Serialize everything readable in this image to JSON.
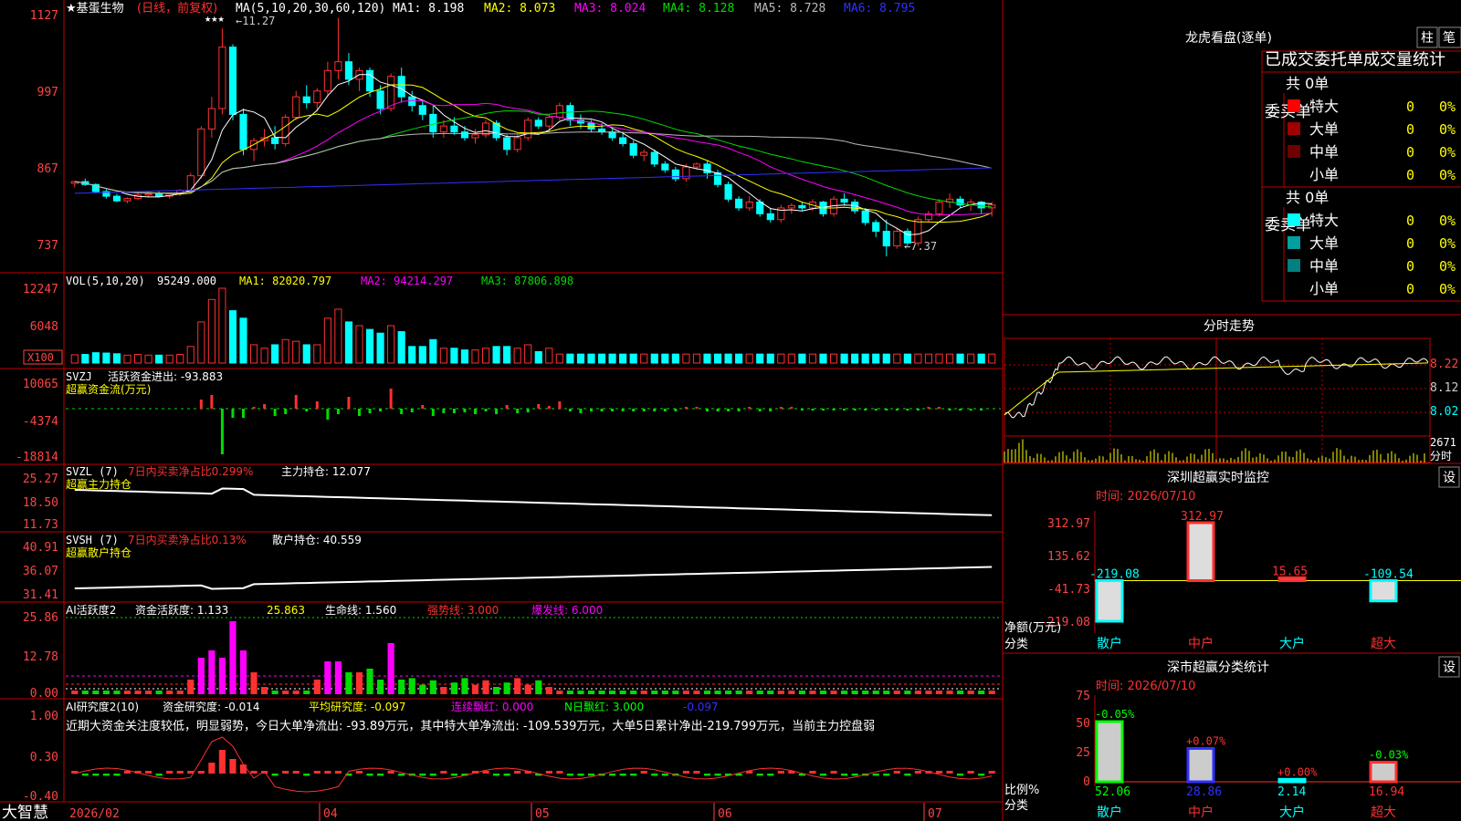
{
  "colors": {
    "up": "#ff3030",
    "down": "#00ffff",
    "frame": "#c00000",
    "white": "#ffffff",
    "yellow": "#ffff00",
    "magenta": "#ff00ff",
    "green": "#00dd00",
    "blue": "#3030ff",
    "gray": "#bbbbbb",
    "label": "#ff4444"
  },
  "main": {
    "stock_name": "★基蛋生物",
    "period": "(日线，前复权)",
    "ma_label": "MA(5,10,20,30,60,120)",
    "ma1": "MA1: 8.198",
    "ma2": "MA2: 8.073",
    "ma3": "MA3: 8.024",
    "ma4": "MA4: 8.128",
    "ma5": "MA5: 8.728",
    "ma6": "MA6: 8.795",
    "high_mark": "←11.27",
    "low_mark": "←7.37",
    "stars": "★★★",
    "y_ticks": [
      "1127",
      "997",
      "867",
      "737"
    ],
    "candles": [
      [
        8.62,
        8.66,
        8.55,
        8.65
      ],
      [
        8.65,
        8.7,
        8.58,
        8.6
      ],
      [
        8.6,
        8.62,
        8.45,
        8.48
      ],
      [
        8.48,
        8.52,
        8.36,
        8.4
      ],
      [
        8.4,
        8.44,
        8.3,
        8.32
      ],
      [
        8.32,
        8.38,
        8.28,
        8.36
      ],
      [
        8.36,
        8.45,
        8.33,
        8.42
      ],
      [
        8.42,
        8.48,
        8.38,
        8.44
      ],
      [
        8.44,
        8.48,
        8.38,
        8.4
      ],
      [
        8.4,
        8.46,
        8.36,
        8.44
      ],
      [
        8.44,
        8.52,
        8.4,
        8.5
      ],
      [
        8.5,
        8.8,
        8.45,
        8.75
      ],
      [
        8.75,
        9.6,
        8.7,
        9.55
      ],
      [
        9.55,
        10.1,
        9.4,
        9.9
      ],
      [
        9.9,
        11.27,
        9.8,
        10.95
      ],
      [
        10.95,
        11.0,
        9.7,
        9.8
      ],
      [
        9.8,
        9.9,
        9.1,
        9.2
      ],
      [
        9.2,
        9.4,
        9.0,
        9.35
      ],
      [
        9.35,
        9.55,
        9.25,
        9.4
      ],
      [
        9.4,
        9.6,
        9.2,
        9.3
      ],
      [
        9.3,
        9.8,
        9.25,
        9.75
      ],
      [
        9.75,
        10.2,
        9.7,
        10.1
      ],
      [
        10.1,
        10.3,
        9.9,
        10.0
      ],
      [
        10.0,
        10.25,
        9.85,
        10.2
      ],
      [
        10.2,
        10.7,
        10.1,
        10.55
      ],
      [
        10.55,
        11.45,
        10.4,
        10.7
      ],
      [
        10.7,
        10.85,
        10.3,
        10.4
      ],
      [
        10.4,
        10.6,
        10.2,
        10.55
      ],
      [
        10.55,
        10.6,
        10.1,
        10.2
      ],
      [
        10.2,
        10.3,
        9.8,
        9.9
      ],
      [
        9.9,
        10.5,
        9.85,
        10.45
      ],
      [
        10.45,
        10.6,
        10.0,
        10.1
      ],
      [
        10.1,
        10.2,
        9.85,
        9.95
      ],
      [
        9.95,
        10.05,
        9.7,
        9.8
      ],
      [
        9.8,
        9.95,
        9.4,
        9.5
      ],
      [
        9.5,
        9.7,
        9.4,
        9.6
      ],
      [
        9.6,
        9.75,
        9.45,
        9.5
      ],
      [
        9.5,
        9.6,
        9.35,
        9.4
      ],
      [
        9.4,
        9.55,
        9.3,
        9.45
      ],
      [
        9.45,
        9.7,
        9.4,
        9.65
      ],
      [
        9.65,
        9.7,
        9.35,
        9.4
      ],
      [
        9.4,
        9.45,
        9.1,
        9.2
      ],
      [
        9.2,
        9.45,
        9.15,
        9.4
      ],
      [
        9.4,
        9.75,
        9.35,
        9.7
      ],
      [
        9.7,
        9.75,
        9.55,
        9.6
      ],
      [
        9.6,
        9.8,
        9.5,
        9.75
      ],
      [
        9.75,
        10.0,
        9.7,
        9.95
      ],
      [
        9.95,
        10.0,
        9.6,
        9.7
      ],
      [
        9.7,
        9.8,
        9.55,
        9.65
      ],
      [
        9.65,
        9.7,
        9.5,
        9.55
      ],
      [
        9.55,
        9.65,
        9.45,
        9.5
      ],
      [
        9.5,
        9.55,
        9.35,
        9.4
      ],
      [
        9.4,
        9.5,
        9.25,
        9.3
      ],
      [
        9.3,
        9.35,
        9.05,
        9.1
      ],
      [
        9.1,
        9.2,
        9.0,
        9.15
      ],
      [
        9.15,
        9.2,
        8.9,
        8.95
      ],
      [
        8.95,
        9.0,
        8.8,
        8.85
      ],
      [
        8.85,
        8.9,
        8.65,
        8.7
      ],
      [
        8.7,
        8.95,
        8.65,
        8.9
      ],
      [
        8.9,
        8.98,
        8.85,
        8.95
      ],
      [
        8.95,
        9.0,
        8.7,
        8.8
      ],
      [
        8.8,
        8.85,
        8.55,
        8.6
      ],
      [
        8.6,
        8.65,
        8.3,
        8.35
      ],
      [
        8.35,
        8.4,
        8.15,
        8.2
      ],
      [
        8.2,
        8.4,
        8.15,
        8.3
      ],
      [
        8.3,
        8.35,
        8.05,
        8.1
      ],
      [
        8.1,
        8.2,
        7.95,
        8.0
      ],
      [
        8.0,
        8.25,
        7.95,
        8.2
      ],
      [
        8.2,
        8.28,
        8.1,
        8.24
      ],
      [
        8.24,
        8.3,
        8.15,
        8.2
      ],
      [
        8.2,
        8.35,
        8.15,
        8.3
      ],
      [
        8.3,
        8.32,
        8.05,
        8.1
      ],
      [
        8.1,
        8.4,
        8.05,
        8.35
      ],
      [
        8.35,
        8.45,
        8.25,
        8.3
      ],
      [
        8.3,
        8.35,
        8.1,
        8.15
      ],
      [
        8.15,
        8.2,
        7.9,
        7.95
      ],
      [
        7.95,
        8.0,
        7.7,
        7.8
      ],
      [
        7.8,
        8.0,
        7.37,
        7.55
      ],
      [
        7.55,
        7.85,
        7.5,
        7.8
      ],
      [
        7.8,
        7.85,
        7.55,
        7.6
      ],
      [
        7.6,
        8.05,
        7.55,
        8.0
      ],
      [
        8.0,
        8.15,
        7.95,
        8.1
      ],
      [
        8.1,
        8.35,
        8.05,
        8.3
      ],
      [
        8.3,
        8.45,
        8.2,
        8.35
      ],
      [
        8.35,
        8.4,
        8.2,
        8.25
      ],
      [
        8.25,
        8.35,
        8.15,
        8.3
      ],
      [
        8.3,
        8.32,
        8.1,
        8.2
      ],
      [
        8.2,
        8.3,
        8.05,
        8.25
      ]
    ]
  },
  "volume": {
    "label": "VOL(5,10,20)",
    "value": "95249.000",
    "ma1": "MA1: 82020.797",
    "ma2": "MA2: 94214.297",
    "ma3": "MA3: 87806.898",
    "unit_label": "X100",
    "y_ticks": [
      "12247",
      "6048"
    ]
  },
  "svzj": {
    "label": "SVZJ",
    "title": "活跃资金进出: -93.883",
    "subtitle": "超赢资金流(万元)",
    "y_ticks": [
      "10065",
      "-4374",
      "-18814"
    ]
  },
  "svzl": {
    "label": "SVZL (7)",
    "ratio": "7日内买卖净占比0.299%",
    "hold": "主力持仓: 12.077",
    "subtitle": "超赢主力持仓",
    "y_ticks": [
      "25.27",
      "18.50",
      "11.73"
    ]
  },
  "svsh": {
    "label": "SVSH (7)",
    "ratio": "7日内买卖净占比0.13%",
    "hold": "散户持仓: 40.559",
    "subtitle": "超赢散户持仓",
    "y_ticks": [
      "40.91",
      "36.07",
      "31.41"
    ]
  },
  "ai_active": {
    "label": "AI活跃度2",
    "activity": "资金活跃度: 1.133",
    "v2": "25.863",
    "life": "生命线: 1.560",
    "strong": "强势线: 3.000",
    "burst": "爆发线: 6.000",
    "y_ticks": [
      "25.86",
      "12.78",
      "0.00"
    ]
  },
  "ai_research": {
    "label": "AI研究度2(10)",
    "research": "资金研究度: -0.014",
    "avg": "平均研究度: -0.097",
    "cont": "连续飘红: 0.000",
    "nday": "N日飘红: 3.000",
    "last": "-0.097",
    "note": "近期大资金关注度较低，明显弱势，今日大单净流出: -93.89万元，其中特大单净流出: -109.539万元，大单5日累计净出-219.799万元，当前主力控盘弱",
    "y_ticks": [
      "1.00",
      "0.30",
      "-0.40"
    ]
  },
  "bottom": {
    "app_name": "大智慧",
    "dates": [
      "2026/02",
      "04",
      "05",
      "06",
      "07"
    ]
  },
  "dragon": {
    "title": "龙虎看盘(逐单)",
    "btn1": "柱",
    "btn2": "笔",
    "header": "已成交委托单成交量统计",
    "buy_label": "委买单",
    "sell_label": "委卖单",
    "buy_total": "共 0单",
    "sell_total": "共 0单",
    "buy_rows": [
      {
        "name": "特大",
        "count": "0",
        "pct": "0%",
        "color": "#ff0000"
      },
      {
        "name": "大单",
        "count": "0",
        "pct": "0%",
        "color": "#a00000"
      },
      {
        "name": "中单",
        "count": "0",
        "pct": "0%",
        "color": "#700000"
      },
      {
        "name": "小单",
        "count": "0",
        "pct": "0%",
        "color": "#000000"
      }
    ],
    "sell_rows": [
      {
        "name": "特大",
        "count": "0",
        "pct": "0%",
        "color": "#00ffff"
      },
      {
        "name": "大单",
        "count": "0",
        "pct": "0%",
        "color": "#00a0a0"
      },
      {
        "name": "中单",
        "count": "0",
        "pct": "0%",
        "color": "#008080"
      },
      {
        "name": "小单",
        "count": "0",
        "pct": "0%",
        "color": "#000000"
      }
    ]
  },
  "intraday": {
    "title": "分时走势",
    "y_ticks": [
      "8.22",
      "8.12",
      "8.02"
    ],
    "vol_label": "2671",
    "unit": "分时"
  },
  "sz_monitor": {
    "title": "深圳超赢实时监控",
    "btn": "设",
    "time": "时间: 2026/07/10",
    "y_ticks": [
      "312.97",
      "135.62",
      "-41.73",
      "-219.08"
    ],
    "bars": [
      {
        "cat": "散户",
        "value": -219.08,
        "label": "-219.08"
      },
      {
        "cat": "中户",
        "value": 312.97,
        "label": "312.97"
      },
      {
        "cat": "大户",
        "value": 15.65,
        "label": "15.65"
      },
      {
        "cat": "超大",
        "value": -109.54,
        "label": "-109.54"
      }
    ],
    "ylabel": "净额(万元)",
    "xlabel": "分类"
  },
  "sz_class": {
    "title": "深市超赢分类统计",
    "btn": "设",
    "time": "时间: 2026/07/10",
    "y_ticks": [
      "75",
      "50",
      "25",
      "0"
    ],
    "bars": [
      {
        "cat": "散户",
        "value": 52.06,
        "label": "52.06",
        "chg": "-0.05%"
      },
      {
        "cat": "中户",
        "value": 28.86,
        "label": "28.86",
        "chg": "+0.07%"
      },
      {
        "cat": "大户",
        "value": 2.14,
        "label": "2.14",
        "chg": "+0.00%"
      },
      {
        "cat": "超大",
        "value": 16.94,
        "label": "16.94",
        "chg": "-0.03%"
      }
    ],
    "ylabel": "比例%",
    "xlabel": "分类"
  },
  "chart_data": [
    {
      "type": "candlestick",
      "title": "基蛋生物 日线",
      "ylim": [
        7.2,
        11.6
      ]
    },
    {
      "type": "bar",
      "title": "深圳超赢实时监控",
      "categories": [
        "散户",
        "中户",
        "大户",
        "超大"
      ],
      "values": [
        -219.08,
        312.97,
        15.65,
        -109.54
      ],
      "ylabel": "净额(万元)",
      "xlabel": "分类"
    },
    {
      "type": "bar",
      "title": "深市超赢分类统计",
      "categories": [
        "散户",
        "中户",
        "大户",
        "超大"
      ],
      "values": [
        52.06,
        28.86,
        2.14,
        16.94
      ],
      "ylabel": "比例%",
      "xlabel": "分类",
      "ylim": [
        0,
        75
      ]
    }
  ]
}
